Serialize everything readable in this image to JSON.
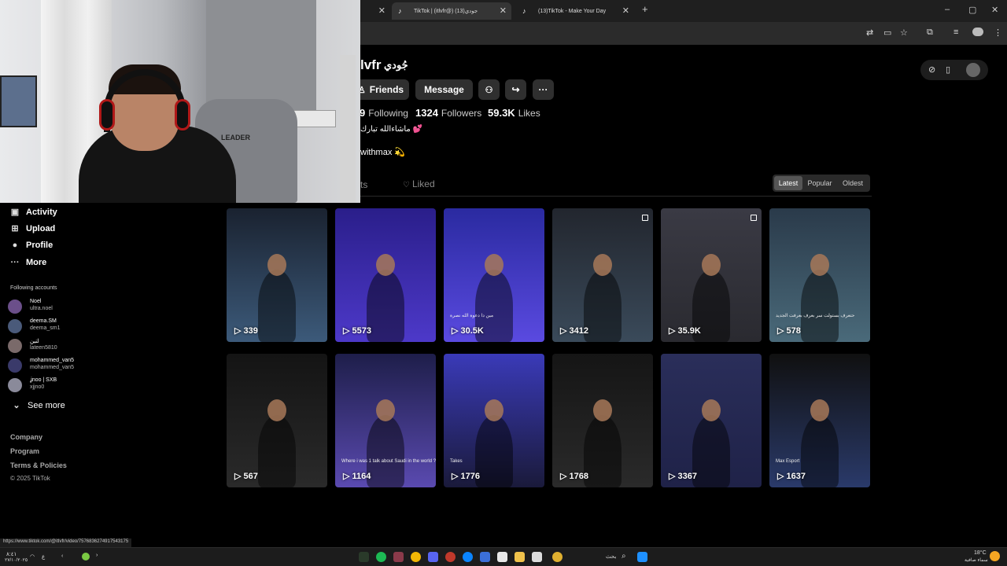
{
  "browser": {
    "tabs": [
      {
        "title": "",
        "active": false
      },
      {
        "title": "TikTok | (itlvfr@) جودي(13)",
        "active": true
      },
      {
        "title": "(13)TikTok - Make Your Day",
        "active": false
      }
    ],
    "new_tab": "+",
    "window_controls": {
      "minimize": "–",
      "maximize": "▢",
      "close": "✕"
    }
  },
  "profile": {
    "username": "lvfr",
    "nickname": "جُودي",
    "buttons": {
      "friends": "Friends",
      "message": "Message"
    },
    "stats": [
      {
        "value": "9",
        "label": "Following"
      },
      {
        "value": "1324",
        "label": "Followers"
      },
      {
        "value": "59.3K",
        "label": "Likes"
      }
    ],
    "bio_line1": "ماشاءالله تبارك 💕",
    "bio_line2": "withmax 💫",
    "tabs": {
      "posts": "ts",
      "liked": "Liked"
    },
    "sort": [
      "Latest",
      "Popular",
      "Oldest"
    ]
  },
  "sidebar": {
    "nav": [
      {
        "icon": "activity-icon",
        "label": "Activity"
      },
      {
        "icon": "upload-icon",
        "label": "Upload"
      },
      {
        "icon": "profile-icon",
        "label": "Profile"
      },
      {
        "icon": "more-icon",
        "label": "More"
      }
    ],
    "following_header": "Following accounts",
    "accounts": [
      {
        "name": "Noel",
        "handle": "ultra.noel",
        "color": "#6b4f8a"
      },
      {
        "name": "deema.SM",
        "handle": "deema_sm1",
        "color": "#4a5a7a"
      },
      {
        "name": "لتين",
        "handle": "lateen5810",
        "color": "#7a6a6a"
      },
      {
        "name": "mohammed_van5",
        "handle": "mohammed_van5",
        "color": "#3a3a6a"
      },
      {
        "name": "ʝnoo | SXB",
        "handle": "xjjno0",
        "color": "#8a8a9a"
      }
    ],
    "see_more": "See more",
    "footer": {
      "company": "Company",
      "program": "Program",
      "terms": "Terms & Policies",
      "copyright": "© 2025 TikTok"
    }
  },
  "videos": [
    {
      "views": "339",
      "bg": "#1a2230",
      "accent": "#3c5a7a"
    },
    {
      "views": "5573",
      "bg": "#2a1e8a",
      "accent": "#4d39c9"
    },
    {
      "views": "30.5K",
      "bg": "#2a2aa0",
      "accent": "#5a4ae0",
      "caption": "مين دا دعوة الله نصرة"
    },
    {
      "views": "3412",
      "bg": "#22262e",
      "accent": "#3a4a5a"
    },
    {
      "views": "35.9K",
      "bg": "#3a3a44",
      "accent": "#2a2a30"
    },
    {
      "views": "578",
      "bg": "#2a3a4a",
      "accent": "#4a6a7a",
      "caption": "حتعرف بستولت سر بعرف بعرفت الجديد"
    },
    {
      "views": "567",
      "bg": "#141414",
      "accent": "#2a2a2a"
    },
    {
      "views": "1164",
      "bg": "#1e1e4a",
      "accent": "#5a4ab0",
      "caption": "Where i was 1 talk about Saudi in the world ?"
    },
    {
      "views": "1776",
      "bg": "#3a3ab8",
      "accent": "#1a1a3a",
      "caption": "Takes"
    },
    {
      "views": "1768",
      "bg": "#151515",
      "accent": "#2a2a2a"
    },
    {
      "views": "3367",
      "bg": "#2a2e5a",
      "accent": "#1f2248"
    },
    {
      "views": "1637",
      "bg": "#101010",
      "accent": "#2a3a6a",
      "caption": "Max Esport"
    }
  ],
  "status_url": "https://www.tiktok.com/@itlvfr/video/7576836274917543175",
  "taskbar": {
    "search_label": "بحث",
    "weather": "18°C",
    "weather_sub": "سماء صافية",
    "time": "٨:٤١",
    "date": "٢٧/١٠/٢٠٢٥",
    "lang": "ع"
  }
}
